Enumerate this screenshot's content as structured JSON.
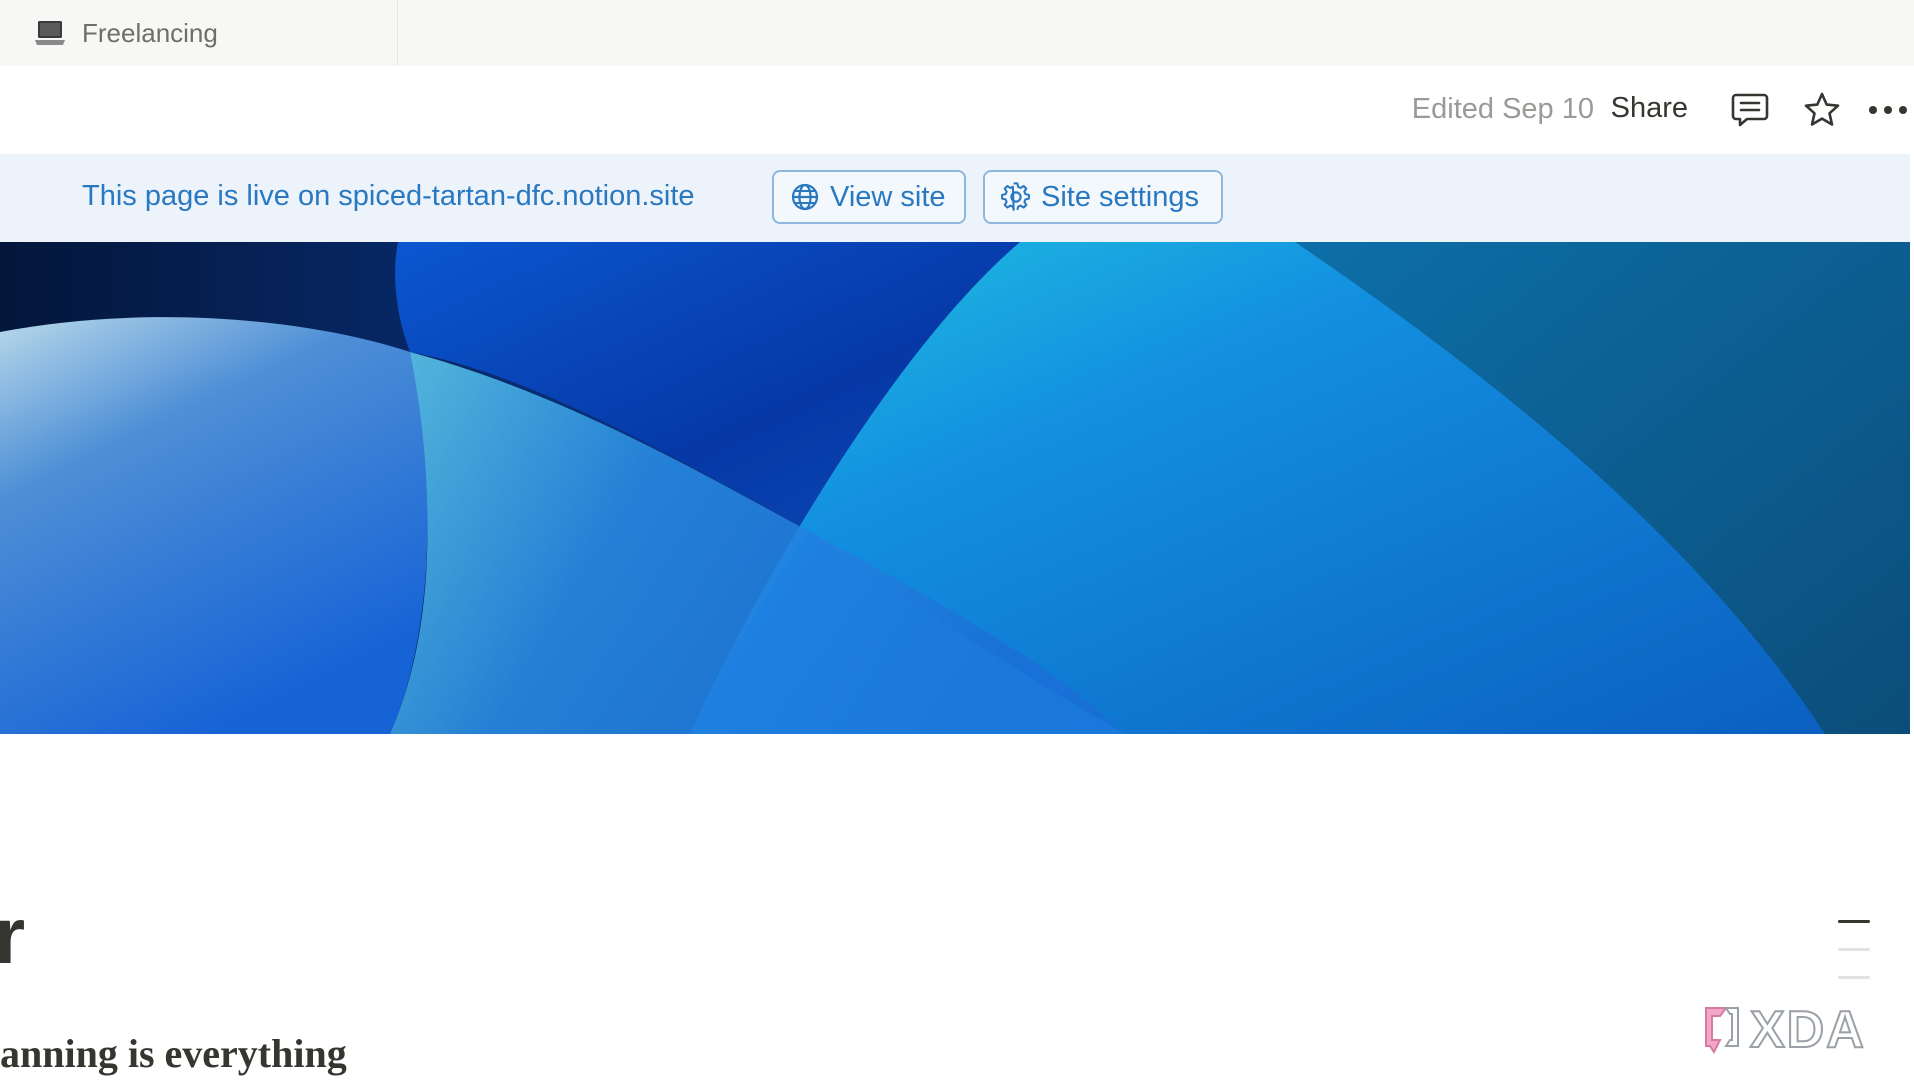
{
  "tab": {
    "icon": "laptop-icon",
    "label": "Freelancing"
  },
  "topbar": {
    "edited": "Edited Sep 10",
    "share": "Share",
    "icons": [
      "comment-icon",
      "star-icon",
      "more-icon"
    ]
  },
  "banner": {
    "text": "This page is live on spiced-tartan-dfc.notion.site",
    "view_site": "View site",
    "view_site_icon": "globe-icon",
    "site_settings": "Site settings",
    "site_settings_icon": "gear-icon",
    "accent": "#2a78c0"
  },
  "cover": {
    "description_colors": [
      "#061b44",
      "#0a5fd6",
      "#1aa0e8",
      "#0b4f93"
    ]
  },
  "page": {
    "title": "r",
    "subheading": "anning is everything"
  },
  "toc": {
    "lines": 3
  },
  "watermark": {
    "text": "XDA"
  }
}
